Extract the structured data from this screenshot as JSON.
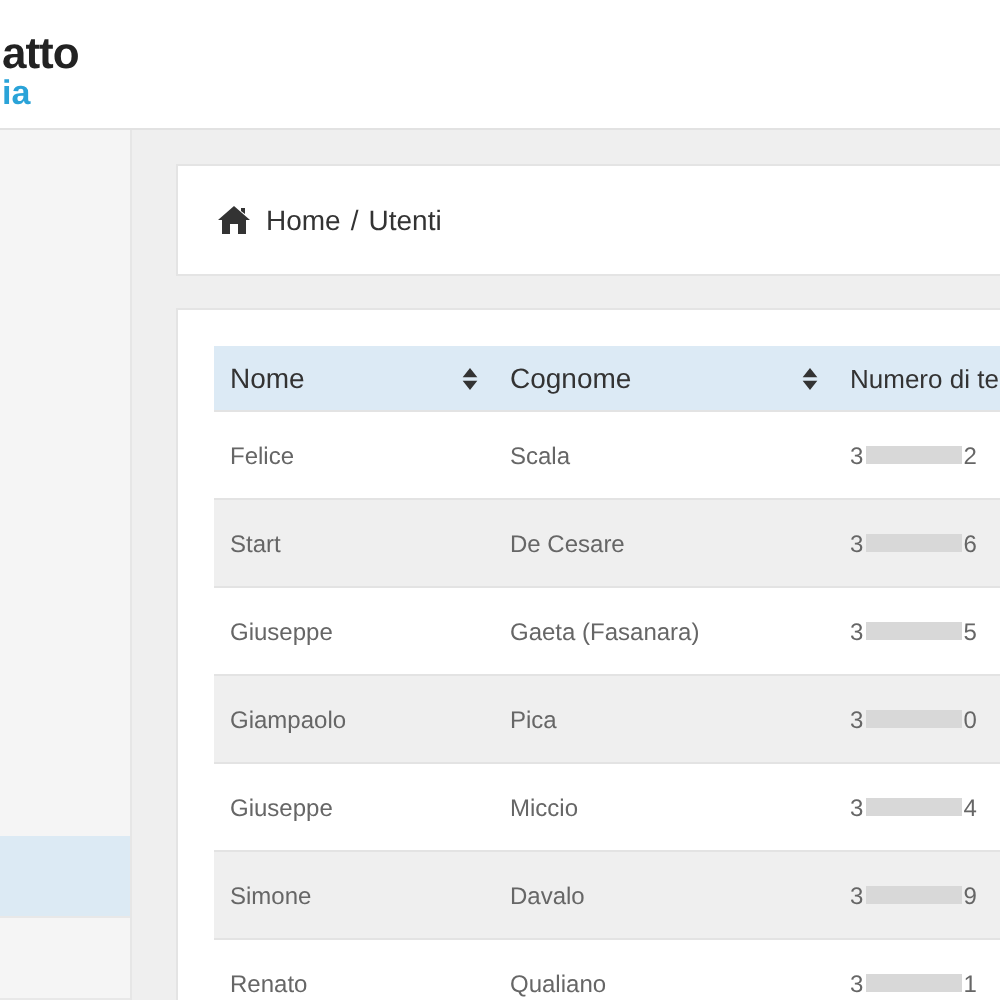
{
  "logo": {
    "line_1": "atto",
    "line_2": "ia"
  },
  "sidebar": {
    "items": [
      {
        "selected": true
      },
      {
        "selected": false
      }
    ]
  },
  "breadcrumb": {
    "items": [
      "Home",
      "Utenti"
    ],
    "separator": "/"
  },
  "table": {
    "columns": [
      {
        "label": "Nome",
        "sortable": true
      },
      {
        "label": "Cognome",
        "sortable": true
      },
      {
        "label": "Numero di te",
        "sortable": false
      }
    ],
    "rows": [
      {
        "nome": "Felice",
        "cognome": "Scala",
        "phone_start": "3",
        "phone_end": "2"
      },
      {
        "nome": "Start",
        "cognome": "De Cesare",
        "phone_start": "3",
        "phone_end": "6"
      },
      {
        "nome": "Giuseppe",
        "cognome": "Gaeta (Fasanara)",
        "phone_start": "3",
        "phone_end": "5"
      },
      {
        "nome": "Giampaolo",
        "cognome": "Pica",
        "phone_start": "3",
        "phone_end": "0"
      },
      {
        "nome": "Giuseppe",
        "cognome": "Miccio",
        "phone_start": "3",
        "phone_end": "4"
      },
      {
        "nome": "Simone",
        "cognome": "Davalo",
        "phone_start": "3",
        "phone_end": "9"
      },
      {
        "nome": "Renato",
        "cognome": "Qualiano",
        "phone_start": "3",
        "phone_end": "1"
      }
    ]
  }
}
